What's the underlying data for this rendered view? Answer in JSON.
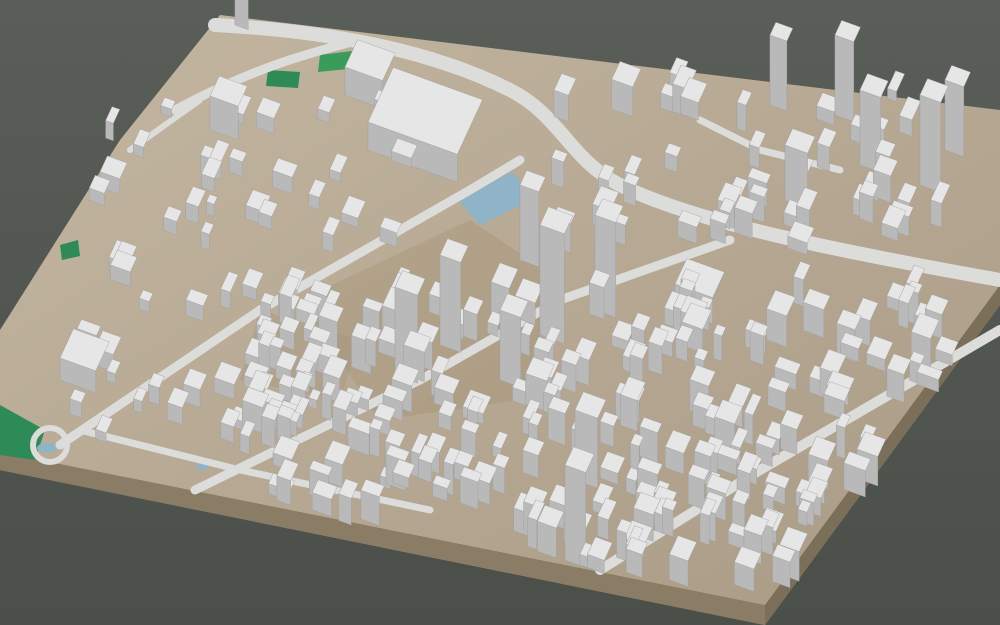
{
  "scene": {
    "kind": "3d-city-block-model",
    "background_color": "#5c6059",
    "terrain_color": "#b7aa96",
    "terrain_side_color": "#8a7b64",
    "terrain_front_color": "#7a6d58",
    "road_color": "#dcdcda",
    "building_top_color": "#e6e6e6",
    "building_left_color": "#d2d2d2",
    "building_right_color": "#b9b9b9",
    "park_color": "#2e8b57",
    "water_color": "#8fb3c7",
    "labels": []
  }
}
